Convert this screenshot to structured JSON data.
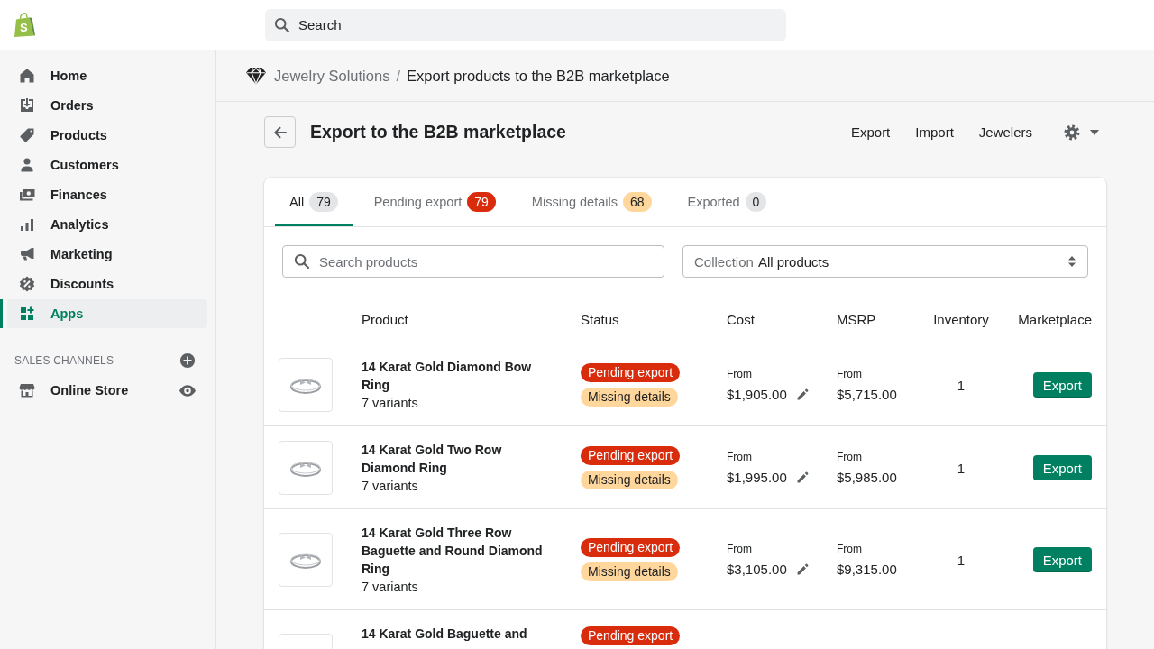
{
  "logo": {
    "letter": "S"
  },
  "top_search": {
    "placeholder": "Search"
  },
  "sidebar": {
    "items": [
      {
        "label": "Home",
        "selected": false
      },
      {
        "label": "Orders",
        "selected": false
      },
      {
        "label": "Products",
        "selected": false
      },
      {
        "label": "Customers",
        "selected": false
      },
      {
        "label": "Finances",
        "selected": false
      },
      {
        "label": "Analytics",
        "selected": false
      },
      {
        "label": "Marketing",
        "selected": false
      },
      {
        "label": "Discounts",
        "selected": false
      },
      {
        "label": "Apps",
        "selected": true
      }
    ],
    "sales_channels": {
      "heading": "SALES CHANNELS",
      "items": [
        {
          "label": "Online Store",
          "selected": false
        }
      ]
    }
  },
  "breadcrumb": {
    "parent": "Jewelry Solutions",
    "separator": "/",
    "current": "Export products to the B2B marketplace"
  },
  "page_header": {
    "title": "Export to the B2B marketplace",
    "actions": [
      "Export",
      "Import",
      "Jewelers"
    ]
  },
  "tabs": [
    {
      "label": "All",
      "count": "79",
      "kind": "neutral",
      "selected": true
    },
    {
      "label": "Pending export",
      "count": "79",
      "kind": "critical",
      "selected": false
    },
    {
      "label": "Missing details",
      "count": "68",
      "kind": "warning",
      "selected": false
    },
    {
      "label": "Exported",
      "count": "0",
      "kind": "neutral",
      "selected": false
    }
  ],
  "filters": {
    "search": {
      "placeholder": "Search products"
    },
    "collection": {
      "label": "Collection",
      "value": "All products"
    }
  },
  "table": {
    "columns": [
      "Product",
      "Status",
      "Cost",
      "MSRP",
      "Inventory",
      "Marketplace"
    ],
    "rows": [
      {
        "name": "14 Karat Gold Diamond Bow Ring",
        "variants": "7 variants",
        "statuses": [
          {
            "label": "Pending export",
            "kind": "critical"
          },
          {
            "label": "Missing details",
            "kind": "warning"
          }
        ],
        "cost": {
          "prefix": "From",
          "value": "$1,905.00"
        },
        "msrp": {
          "prefix": "From",
          "value": "$5,715.00"
        },
        "inventory": "1",
        "action": "Export"
      },
      {
        "name": "14 Karat Gold Two Row Diamond Ring",
        "variants": "7 variants",
        "statuses": [
          {
            "label": "Pending export",
            "kind": "critical"
          },
          {
            "label": "Missing details",
            "kind": "warning"
          }
        ],
        "cost": {
          "prefix": "From",
          "value": "$1,995.00"
        },
        "msrp": {
          "prefix": "From",
          "value": "$5,985.00"
        },
        "inventory": "1",
        "action": "Export"
      },
      {
        "name": "14 Karat Gold Three Row Baguette and Round Diamond Ring",
        "variants": "7 variants",
        "statuses": [
          {
            "label": "Pending export",
            "kind": "critical"
          },
          {
            "label": "Missing details",
            "kind": "warning"
          }
        ],
        "cost": {
          "prefix": "From",
          "value": "$3,105.00"
        },
        "msrp": {
          "prefix": "From",
          "value": "$9,315.00"
        },
        "inventory": "1",
        "action": "Export"
      },
      {
        "name": "14 Karat Gold Baguette and",
        "statuses": [
          {
            "label": "Pending export",
            "kind": "critical"
          }
        ]
      }
    ]
  }
}
